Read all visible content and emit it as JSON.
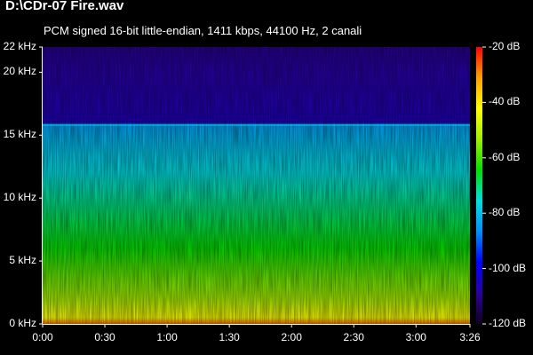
{
  "header": {
    "title": "D:\\CDr-07 Fire.wav",
    "subtitle": "PCM signed 16-bit little-endian, 1411 kbps, 44100 Hz, 2 canali"
  },
  "chart_data": {
    "type": "heatmap",
    "title": "D:\\CDr-07 Fire.wav",
    "subtitle": "PCM signed 16-bit little-endian, 1411 kbps, 44100 Hz, 2 canali",
    "x_axis": {
      "ticks": [
        "0:00",
        "0:30",
        "1:00",
        "1:30",
        "2:00",
        "2:30",
        "3:00",
        "3:26"
      ],
      "tick_seconds": [
        0,
        30,
        60,
        90,
        120,
        150,
        180,
        206
      ],
      "range_seconds": [
        0,
        206
      ]
    },
    "y_axis": {
      "ticks": [
        "0 kHz",
        "5 kHz",
        "10 kHz",
        "15 kHz",
        "20 kHz",
        "22 kHz"
      ],
      "tick_khz": [
        0,
        5,
        10,
        15,
        20,
        22
      ],
      "range_khz": [
        0,
        22
      ]
    },
    "colorbar": {
      "ticks": [
        "-20 dB",
        "-40 dB",
        "-60 dB",
        "-80 dB",
        "-100 dB",
        "-120 dB"
      ],
      "tick_db": [
        -20,
        -40,
        -60,
        -80,
        -100,
        -120
      ],
      "range_db": [
        -120,
        -20
      ],
      "colors": [
        "#110018",
        "#2a00a0",
        "#0000ff",
        "#0090ff",
        "#00e0e0",
        "#00e000",
        "#a0f000",
        "#ffff00",
        "#ffa000",
        "#ff0000"
      ]
    },
    "spectrum_profile": {
      "freq_khz": [
        0,
        0.5,
        2,
        4,
        6,
        8,
        10,
        12,
        14,
        15.8,
        16,
        20,
        22
      ],
      "level_db": [
        -28,
        -42,
        -52,
        -58,
        -64,
        -68,
        -72,
        -76,
        -80,
        -84,
        -106,
        -108,
        -110
      ]
    },
    "cutoff_khz": 15.8,
    "grid": false
  }
}
